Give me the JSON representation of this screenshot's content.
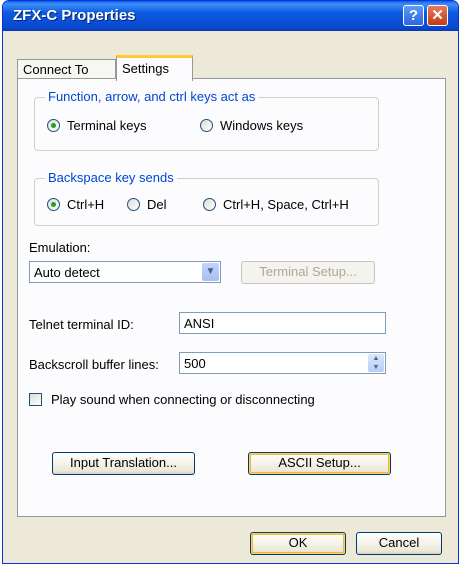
{
  "window": {
    "title": "ZFX-C Properties"
  },
  "titlebar": {
    "help_label": "?",
    "close_label": "✕"
  },
  "tabs": [
    {
      "label": "Connect To"
    },
    {
      "label": "Settings"
    }
  ],
  "keys_group": {
    "legend": "Function, arrow, and ctrl keys act as",
    "options": [
      {
        "label": "Terminal keys",
        "selected": true
      },
      {
        "label": "Windows keys",
        "selected": false
      }
    ]
  },
  "backspace_group": {
    "legend": "Backspace key sends",
    "options": [
      {
        "label": "Ctrl+H",
        "selected": true
      },
      {
        "label": "Del",
        "selected": false
      },
      {
        "label": "Ctrl+H, Space, Ctrl+H",
        "selected": false
      }
    ]
  },
  "emulation": {
    "label": "Emulation:",
    "value": "Auto detect",
    "terminal_setup_label": "Terminal Setup..."
  },
  "telnet": {
    "label": "Telnet terminal ID:",
    "value": "ANSI"
  },
  "backscroll": {
    "label": "Backscroll buffer lines:",
    "value": "500"
  },
  "sound": {
    "label": "Play sound when connecting or disconnecting",
    "checked": false
  },
  "buttons": {
    "input_translation": "Input Translation...",
    "ascii_setup": "ASCII Setup...",
    "ok": "OK",
    "cancel": "Cancel"
  },
  "icons": {
    "combo": "chevron-down-icon",
    "spin_up": "spin-up-icon",
    "spin_down": "spin-down-icon"
  },
  "colors": {
    "title_bar": "#0a5fe8",
    "dialog_bg": "#ece9d8",
    "group_legend": "#0046d5",
    "radio_dot": "#21a121",
    "tab_highlight": "#ffc83c"
  }
}
